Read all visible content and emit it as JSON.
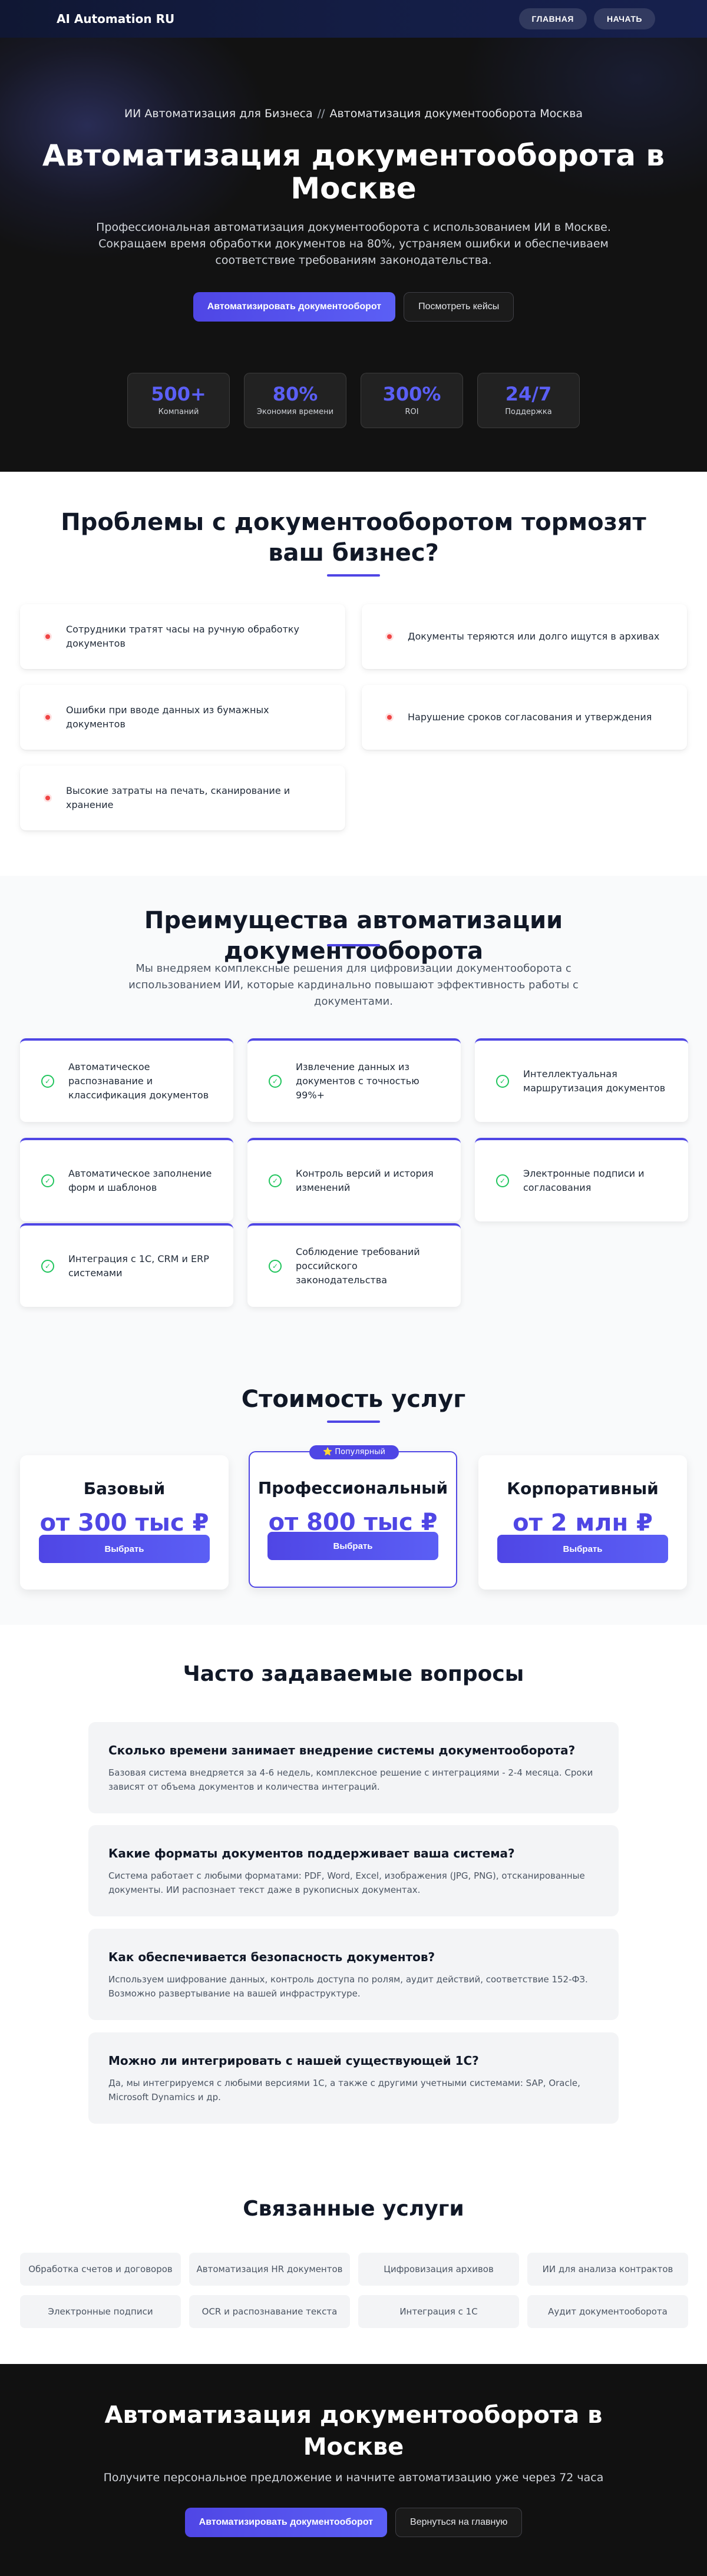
{
  "nav": {
    "brand": "AI Automation RU",
    "links": [
      "ГЛАВНАЯ",
      "НАЧАТЬ"
    ]
  },
  "hero": {
    "breadcrumb": [
      "ИИ Автоматизация для Бизнеса",
      "//",
      "Автоматизация документооборота Москва"
    ],
    "title": "Автоматизация документооборота в Москве",
    "subtitle": "Профессиональная автоматизация документооборота с использованием ИИ в Москве. Сокращаем время обработки документов на 80%, устраняем ошибки и обеспечиваем соответствие требованиям законодательства.",
    "primary_cta": "Автоматизировать документооборот",
    "secondary_cta": "Посмотреть кейсы",
    "stats": [
      {
        "value": "500+",
        "label": "Компаний"
      },
      {
        "value": "80%",
        "label": "Экономия времени"
      },
      {
        "value": "300%",
        "label": "ROI"
      },
      {
        "value": "24/7",
        "label": "Поддержка"
      }
    ]
  },
  "problems": {
    "title": "Проблемы с документооборотом тормозят ваш бизнес?",
    "items": [
      "Сотрудники тратят часы на ручную обработку документов",
      "Документы теряются или долго ищутся в архивах",
      "Ошибки при вводе данных из бумажных документов",
      "Нарушение сроков согласования и утверждения",
      "Высокие затраты на печать, сканирование и хранение"
    ]
  },
  "benefits": {
    "title": "Преимущества автоматизации документооборота",
    "lead": "Мы внедряем комплексные решения для цифровизации документооборота с использованием ИИ, которые кардинально повышают эффективность работы с документами.",
    "items": [
      "Автоматическое распознавание и классификация документов",
      "Извлечение данных из документов с точностью 99%+",
      "Интеллектуальная маршрутизация документов",
      "Автоматическое заполнение форм и шаблонов",
      "Контроль версий и история изменений",
      "Электронные подписи и согласования",
      "Интеграция с 1С, CRM и ERP системами",
      "Соблюдение требований российского законодательства"
    ]
  },
  "pricing": {
    "title": "Стоимость услуг",
    "badge": "⭐ Популярный",
    "plans": [
      {
        "name": "Базовый",
        "price": "от 300 тыс ₽",
        "button": "Выбрать"
      },
      {
        "name": "Профессиональный",
        "price": "от 800 тыс ₽",
        "button": "Выбрать"
      },
      {
        "name": "Корпоративный",
        "price": "от 2 млн ₽",
        "button": "Выбрать"
      }
    ]
  },
  "faq": {
    "title": "Часто задаваемые вопросы",
    "items": [
      {
        "q": "Сколько времени занимает внедрение системы документооборота?",
        "a": "Базовая система внедряется за 4-6 недель, комплексное решение с интеграциями - 2-4 месяца. Сроки зависят от объема документов и количества интеграций."
      },
      {
        "q": "Какие форматы документов поддерживает ваша система?",
        "a": "Система работает с любыми форматами: PDF, Word, Excel, изображения (JPG, PNG), отсканированные документы. ИИ распознает текст даже в рукописных документах."
      },
      {
        "q": "Как обеспечивается безопасность документов?",
        "a": "Используем шифрование данных, контроль доступа по ролям, аудит действий, соответствие 152-ФЗ. Возможно развертывание на вашей инфраструктуре."
      },
      {
        "q": "Можно ли интегрировать с нашей существующей 1С?",
        "a": "Да, мы интегрируемся с любыми версиями 1С, а также с другими учетными системами: SAP, Oracle, Microsoft Dynamics и др."
      }
    ]
  },
  "related": {
    "title": "Связанные услуги",
    "items": [
      "Обработка счетов и договоров",
      "Автоматизация HR документов",
      "Цифровизация архивов",
      "ИИ для анализа контрактов",
      "Электронные подписи",
      "OCR и распознавание текста",
      "Интеграция с 1С",
      "Аудит документооборота"
    ]
  },
  "cta": {
    "title": "Автоматизация документооборота в Москве",
    "subtitle": "Получите персональное предложение и начните автоматизацию уже через 72 часа",
    "primary": "Автоматизировать документооборот",
    "secondary": "Вернуться на главную"
  }
}
